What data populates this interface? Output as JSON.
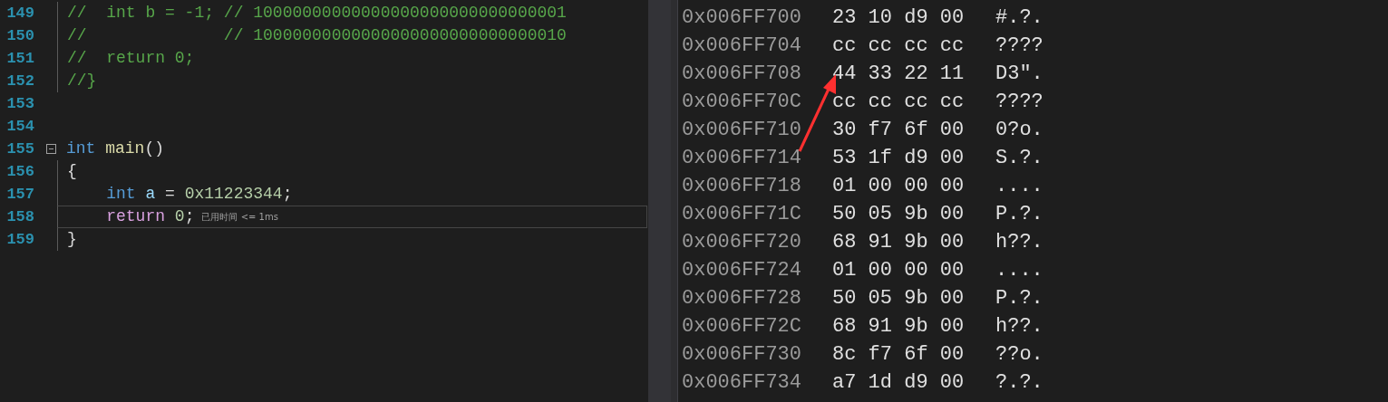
{
  "editor": {
    "lines": [
      {
        "number": "149",
        "in_block": true,
        "current": false,
        "foldable": false,
        "tokens": [
          {
            "kind": "comment",
            "text": "//  int b = -1; // 10000000000000000000000000000001"
          }
        ]
      },
      {
        "number": "150",
        "in_block": true,
        "current": false,
        "foldable": false,
        "tokens": [
          {
            "kind": "comment",
            "text": "//              // 10000000000000000000000000000010"
          }
        ]
      },
      {
        "number": "151",
        "in_block": true,
        "current": false,
        "foldable": false,
        "tokens": [
          {
            "kind": "comment",
            "text": "//  return 0;"
          }
        ]
      },
      {
        "number": "152",
        "in_block": true,
        "current": false,
        "foldable": false,
        "tokens": [
          {
            "kind": "comment",
            "text": "//}"
          }
        ]
      },
      {
        "number": "153",
        "in_block": false,
        "current": false,
        "foldable": false
      },
      {
        "number": "154",
        "in_block": false,
        "current": false,
        "foldable": false
      },
      {
        "number": "155",
        "in_block": false,
        "current": false,
        "foldable": true,
        "tokens": [
          {
            "kind": "keyword",
            "text": "int "
          },
          {
            "kind": "function",
            "text": "main"
          },
          {
            "kind": "punct",
            "text": "()"
          }
        ]
      },
      {
        "number": "156",
        "in_block": true,
        "current": false,
        "foldable": false,
        "tokens": [
          {
            "kind": "punct",
            "text": "{"
          }
        ]
      },
      {
        "number": "157",
        "in_block": true,
        "current": false,
        "foldable": false,
        "tokens": [
          {
            "kind": "keyword",
            "text": "    int "
          },
          {
            "kind": "variable",
            "text": "a"
          },
          {
            "kind": "punct",
            "text": " = "
          },
          {
            "kind": "number",
            "text": "0x11223344"
          },
          {
            "kind": "punct",
            "text": ";"
          }
        ]
      },
      {
        "number": "158",
        "in_block": true,
        "current": true,
        "foldable": false,
        "hint": "已用时间 <= 1ms",
        "tokens": [
          {
            "kind": "control",
            "text": "    return "
          },
          {
            "kind": "number",
            "text": "0"
          },
          {
            "kind": "punct",
            "text": ";"
          }
        ]
      },
      {
        "number": "159",
        "in_block": true,
        "current": false,
        "foldable": false,
        "tokens": [
          {
            "kind": "punct",
            "text": "}"
          }
        ]
      }
    ]
  },
  "memory": {
    "rows": [
      {
        "address": "0x006FF700",
        "bytes": "23 10 d9 00",
        "ascii": "#.?."
      },
      {
        "address": "0x006FF704",
        "bytes": "cc cc cc cc",
        "ascii": "????"
      },
      {
        "address": "0x006FF708",
        "bytes": "44 33 22 11",
        "ascii": "D3\"."
      },
      {
        "address": "0x006FF70C",
        "bytes": "cc cc cc cc",
        "ascii": "????"
      },
      {
        "address": "0x006FF710",
        "bytes": "30 f7 6f 00",
        "ascii": "0?o."
      },
      {
        "address": "0x006FF714",
        "bytes": "53 1f d9 00",
        "ascii": "S.?."
      },
      {
        "address": "0x006FF718",
        "bytes": "01 00 00 00",
        "ascii": "...."
      },
      {
        "address": "0x006FF71C",
        "bytes": "50 05 9b 00",
        "ascii": "P.?."
      },
      {
        "address": "0x006FF720",
        "bytes": "68 91 9b 00",
        "ascii": "h??."
      },
      {
        "address": "0x006FF724",
        "bytes": "01 00 00 00",
        "ascii": "...."
      },
      {
        "address": "0x006FF728",
        "bytes": "50 05 9b 00",
        "ascii": "P.?."
      },
      {
        "address": "0x006FF72C",
        "bytes": "68 91 9b 00",
        "ascii": "h??."
      },
      {
        "address": "0x006FF730",
        "bytes": "8c f7 6f 00",
        "ascii": "??o."
      },
      {
        "address": "0x006FF734",
        "bytes": "a7 1d d9 00",
        "ascii": "?.?."
      }
    ]
  }
}
